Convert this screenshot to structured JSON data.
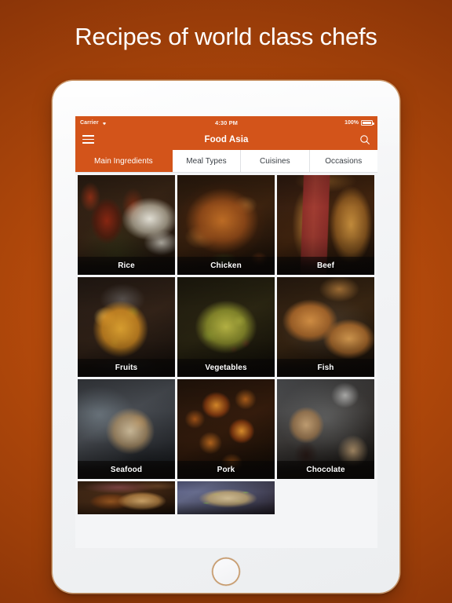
{
  "promo": {
    "headline": "Recipes of world class chefs"
  },
  "device": {
    "kind": "tablet",
    "frame_color": "#f3f4f6",
    "home_button_ring_color": "#c79a6b"
  },
  "theme": {
    "accent": "#d3541a",
    "background_center": "#c4510d",
    "background_edge": "#7d2e07",
    "tab_text": "#3a3f45",
    "caption_text": "#ffffff"
  },
  "status_bar": {
    "carrier": "Carrier",
    "wifi_icon": "wifi-icon",
    "time": "4:30 PM",
    "battery_percent": "100%",
    "battery_icon": "battery-full-icon"
  },
  "nav_bar": {
    "menu_icon": "hamburger-menu-icon",
    "title": "Food Asia",
    "search_icon": "search-icon"
  },
  "tabs": [
    {
      "label": "Main Ingredients",
      "active": true
    },
    {
      "label": "Meal Types",
      "active": false
    },
    {
      "label": "Cuisines",
      "active": false
    },
    {
      "label": "Occasions",
      "active": false
    }
  ],
  "grid": {
    "columns": 3,
    "tiles": [
      {
        "label": "Rice",
        "art": "p-rice",
        "subject": "grilled-prawns-over-herbed-rice"
      },
      {
        "label": "Chicken",
        "art": "p-chicken",
        "subject": "roast-whole-chicken"
      },
      {
        "label": "Beef",
        "art": "p-beef",
        "subject": "beef-wellington-slice"
      },
      {
        "label": "Fruits",
        "art": "p-fruits",
        "subject": "mango-salsa-in-glass-bowl"
      },
      {
        "label": "Vegetables",
        "art": "p-vegetables",
        "subject": "shredded-brussels-sprouts-salad"
      },
      {
        "label": "Fish",
        "art": "p-fish",
        "subject": "grilled-salmon-fillets"
      },
      {
        "label": "Seafood",
        "art": "p-seafood",
        "subject": "baked-oysters-on-ice"
      },
      {
        "label": "Pork",
        "art": "p-pork",
        "subject": "glazed-sausage-slices"
      },
      {
        "label": "Chocolate",
        "art": "p-chocolate",
        "subject": "frosted-cupcakes"
      },
      {
        "label": "",
        "art": "p-bread",
        "subject": "toasted-bread-slices",
        "partial": true
      },
      {
        "label": "",
        "art": "p-risotto",
        "subject": "rice-with-peas",
        "partial": true
      }
    ]
  }
}
